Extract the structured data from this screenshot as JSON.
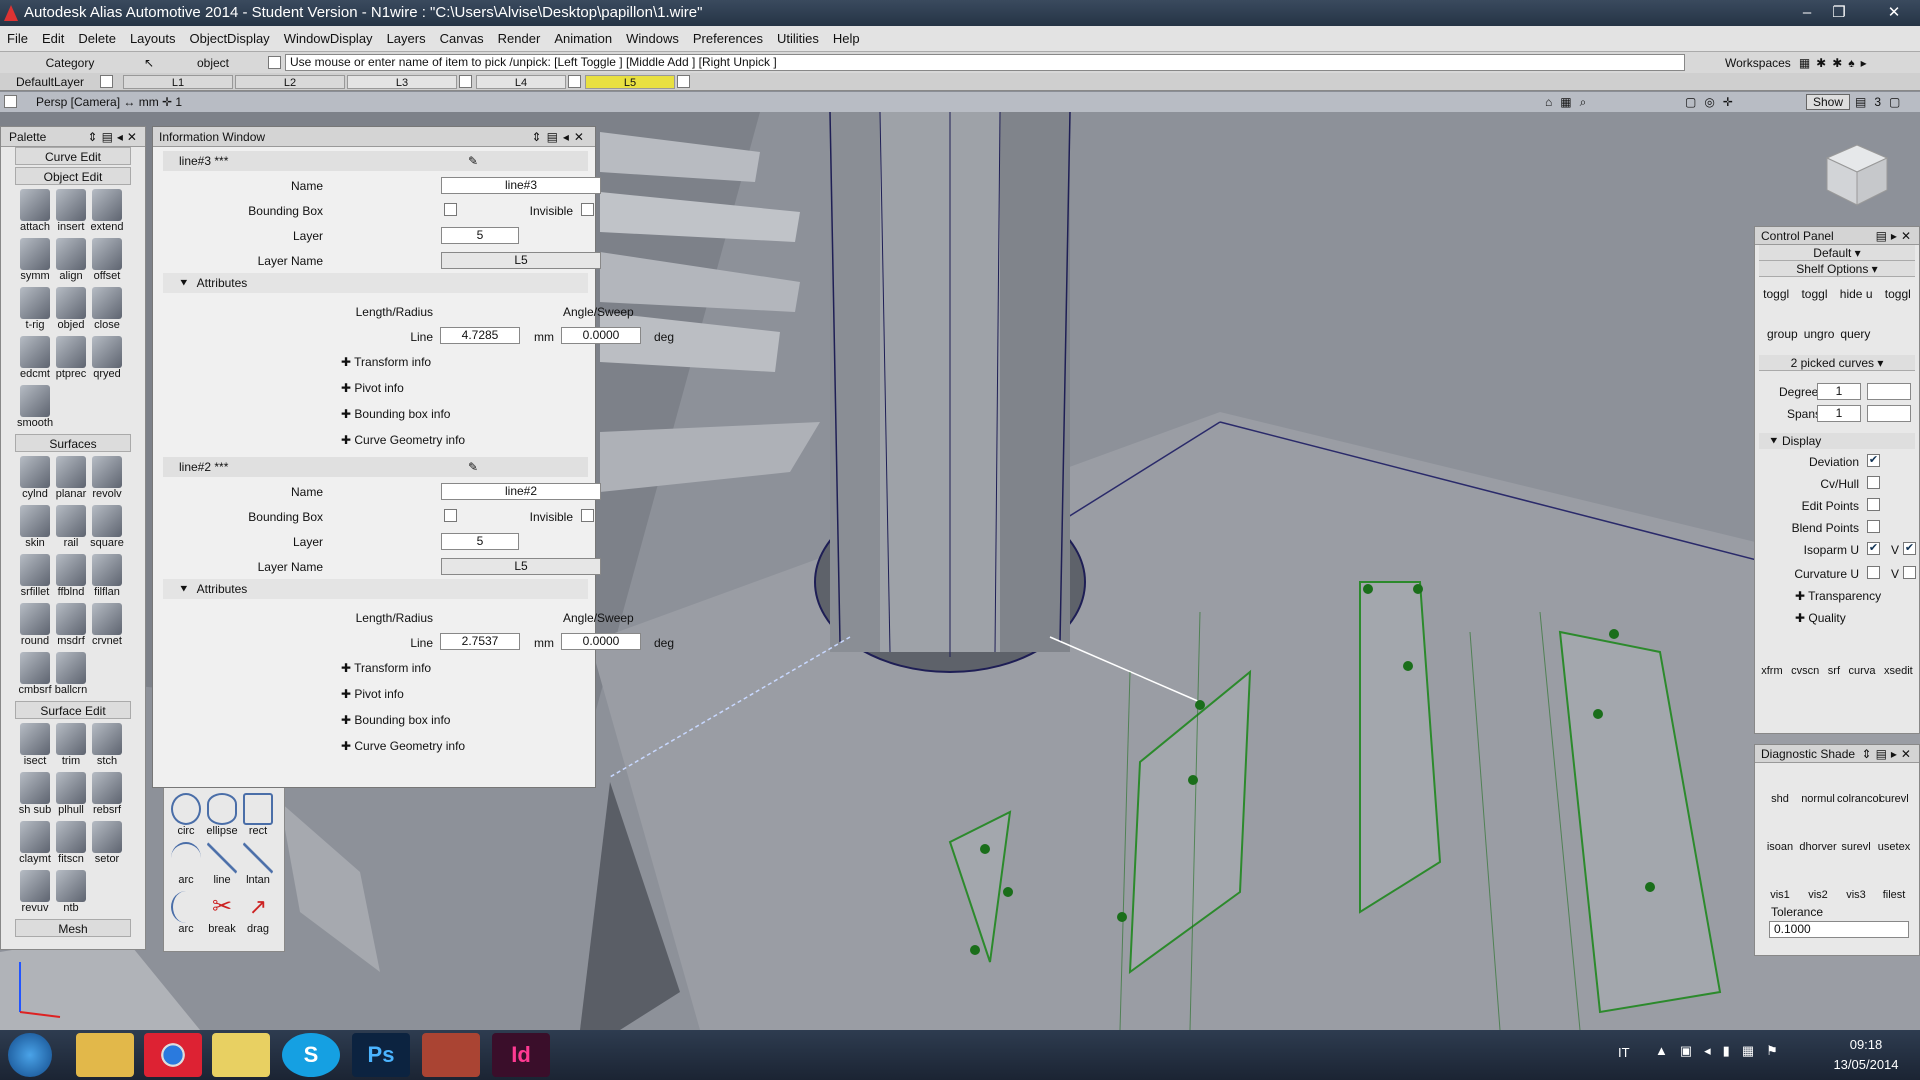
{
  "window": {
    "title": "Autodesk Alias Automotive 2014   - Student Version   - N1wire : \"C:\\Users\\Alvise\\Desktop\\papillon\\1.wire\"",
    "minimize": "–",
    "maximize": "❐",
    "close": "✕"
  },
  "menu": [
    "File",
    "Edit",
    "Delete",
    "Layouts",
    "ObjectDisplay",
    "WindowDisplay",
    "Layers",
    "Canvas",
    "Render",
    "Animation",
    "Windows",
    "Preferences",
    "Utilities",
    "Help"
  ],
  "pickbar": {
    "category": "Category",
    "object": "object",
    "prompt": "Use mouse or enter name of item to pick /unpick: [Left Toggle ] [Middle Add ] [Right Unpick ]",
    "workspaces": "Workspaces"
  },
  "layers": {
    "default": "DefaultLayer",
    "l1": "L1",
    "l2": "L2",
    "l3": "L3",
    "l4": "L4",
    "l5": "L5"
  },
  "view": {
    "label": "Persp [Camera]  ↔ mm  ✛ 1",
    "show": "Show"
  },
  "palette": {
    "title": "Palette",
    "top": "Curve Edit",
    "sections": [
      {
        "name": "Object Edit",
        "tools": [
          "attach",
          "insert",
          "extend",
          "symm",
          "align",
          "offset",
          "t-rig",
          "objed",
          "close",
          "edcmt",
          "ptprec",
          "qryed",
          "smooth"
        ]
      },
      {
        "name": "Surfaces",
        "tools": [
          "cylnd",
          "planar",
          "revolv",
          "skin",
          "rail",
          "square",
          "srfillet",
          "ffblnd",
          "filflan",
          "round",
          "msdrf",
          "crvnet",
          "cmbsrf",
          "ballcrn"
        ]
      },
      {
        "name": "Surface Edit",
        "tools": [
          "isect",
          "trim",
          "stch",
          "sh sub",
          "plhull",
          "rebsrf",
          "claymt",
          "fitscn",
          "setor",
          "revuv",
          "ntb"
        ]
      }
    ],
    "bottom": "Mesh"
  },
  "curvetools": [
    "circ",
    "ellipse",
    "rect",
    "arc",
    "line",
    "lntan",
    "arc",
    "break",
    "drag"
  ],
  "info": {
    "title": "Information Window",
    "obj1": {
      "header": "line#3 ***",
      "name": "line#3",
      "layer": "5",
      "layername": "L5",
      "length": "4.7285",
      "angle": "0.0000"
    },
    "obj2": {
      "header": "line#2 ***",
      "name": "line#2",
      "layer": "5",
      "layername": "L5",
      "length": "2.7537",
      "angle": "0.0000"
    },
    "labels": {
      "name": "Name",
      "bbox": "Bounding Box",
      "invisible": "Invisible",
      "layer": "Layer",
      "layername": "Layer Name",
      "attributes": "Attributes",
      "lenrad": "Length/Radius",
      "angsweep": "Angle/Sweep",
      "line": "Line",
      "mm": "mm",
      "deg": "deg",
      "transform": "Transform info",
      "pivot": "Pivot info",
      "bboxinfo": "Bounding box info",
      "geom": "Curve Geometry info"
    }
  },
  "control": {
    "title": "Control Panel",
    "default": "Default",
    "shelf": "Shelf Options",
    "tools1": [
      "toggl",
      "toggl",
      "hide u",
      "toggl"
    ],
    "tools2": [
      "group",
      "ungro",
      "query"
    ],
    "picked": "2 picked curves",
    "degree_label": "Degree",
    "degree": "1",
    "spans_label": "Spans",
    "spans": "1",
    "display": "Display",
    "opts": [
      {
        "label": "Deviation",
        "checked": true
      },
      {
        "label": "Cv/Hull",
        "checked": false
      },
      {
        "label": "Edit Points",
        "checked": false
      },
      {
        "label": "Blend Points",
        "checked": false
      },
      {
        "label": "Isoparm U",
        "checked": true,
        "v": true
      },
      {
        "label": "Curvature U",
        "checked": false,
        "v": false
      }
    ],
    "v": "V",
    "transparency": "Transparency",
    "quality": "Quality",
    "tools3": [
      "xfrm",
      "cvscn",
      "srf",
      "curva",
      "xsedit"
    ]
  },
  "diag": {
    "title": "Diagnostic Shade",
    "tools": [
      "shd",
      "normul",
      "colrancol",
      "curevl",
      "isoan",
      "dhorver",
      "surevl",
      "usetex",
      "vis1",
      "vis2",
      "vis3",
      "filest"
    ],
    "tolerance_label": "Tolerance",
    "tolerance": "0.1000"
  },
  "taskbar": {
    "lang": "IT",
    "time": "09:18",
    "date": "13/05/2014",
    "apps": [
      "explorer",
      "chrome",
      "files",
      "skype",
      "photoshop",
      "alias",
      "indesign"
    ],
    "ps": "Ps",
    "id": "Id",
    "s": "S"
  }
}
